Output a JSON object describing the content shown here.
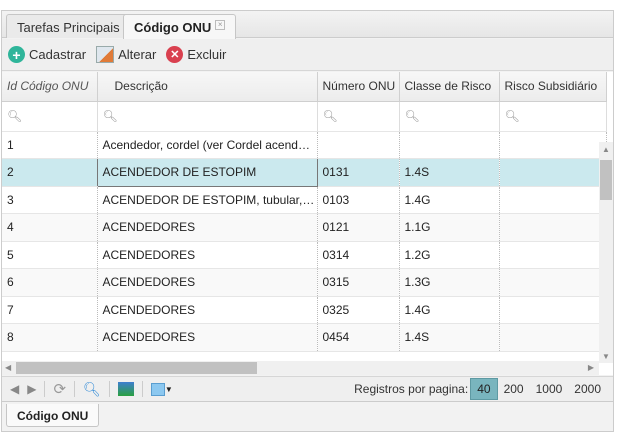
{
  "tabs": [
    {
      "label": "Tarefas Principais"
    },
    {
      "label": "Código ONU",
      "close": "×"
    }
  ],
  "toolbar": {
    "add": "Cadastrar",
    "edit": "Alterar",
    "delete": "Excluir"
  },
  "columns": [
    "Id Código ONU",
    "Descrição",
    "Número ONU",
    "Classe de Risco",
    "Risco Subsidiário"
  ],
  "rows": [
    {
      "id": "1",
      "desc": "Acendedor, cordel (ver Cordel acendedor)",
      "num": "",
      "classe": "",
      "risco": ""
    },
    {
      "id": "2",
      "desc": "ACENDEDOR DE ESTOPIM",
      "num": "0131",
      "classe": "1.4S",
      "risco": ""
    },
    {
      "id": "3",
      "desc": "ACENDEDOR DE ESTOPIM, tubular, com revestimento metálico",
      "num": "0103",
      "classe": "1.4G",
      "risco": ""
    },
    {
      "id": "4",
      "desc": "ACENDEDORES",
      "num": "0121",
      "classe": "1.1G",
      "risco": ""
    },
    {
      "id": "5",
      "desc": "ACENDEDORES",
      "num": "0314",
      "classe": "1.2G",
      "risco": ""
    },
    {
      "id": "6",
      "desc": "ACENDEDORES",
      "num": "0315",
      "classe": "1.3G",
      "risco": ""
    },
    {
      "id": "7",
      "desc": "ACENDEDORES",
      "num": "0325",
      "classe": "1.4G",
      "risco": ""
    },
    {
      "id": "8",
      "desc": "ACENDEDORES",
      "num": "0454",
      "classe": "1.4S",
      "risco": ""
    }
  ],
  "pager": {
    "label": "Registros por pagina:",
    "sizes": [
      "40",
      "200",
      "1000",
      "2000"
    ],
    "selected": "40"
  },
  "bottom_tab": "Código ONU"
}
